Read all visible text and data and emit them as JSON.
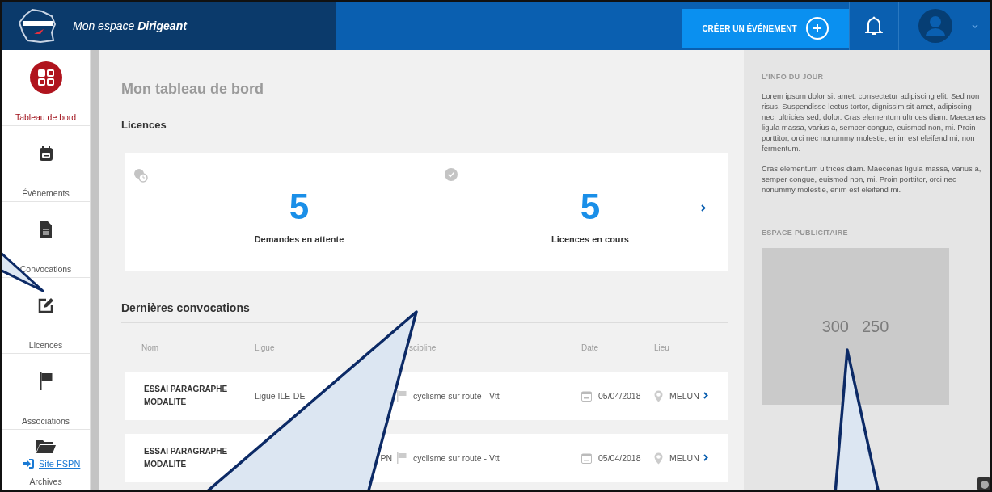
{
  "header": {
    "title": "Mon espace **Dirigeant**",
    "create_button": "CRÉER UN ÉVÉNEMENT"
  },
  "sidebar": {
    "items": [
      {
        "label": "Tableau de bord",
        "selected": true
      },
      {
        "label": "Évènements",
        "selected": false
      },
      {
        "label": "Convocations",
        "selected": false
      },
      {
        "label": "Licences",
        "selected": false
      },
      {
        "label": "Associations",
        "selected": false
      },
      {
        "label": "Archives",
        "selected": false
      }
    ],
    "site_link": "Site FSPN"
  },
  "page_title": "Mon tableau de bord",
  "licences": {
    "title": "Licences",
    "stats": [
      {
        "value": "5",
        "label": "Demandes en attente"
      },
      {
        "value": "5",
        "label": "Licences en cours"
      }
    ]
  },
  "convocations": {
    "title": "Dernières convocations",
    "columns": [
      "Nom",
      "Ligue",
      "scipline",
      "Date",
      "Lieu"
    ],
    "rows": [
      {
        "name": "ESSAI PARAGRAPHE MODALITE",
        "ligue": "Ligue ILE-DE-",
        "discipline": "cyclisme sur route - Vtt",
        "date": "05/04/2018",
        "lieu": "MELUN"
      },
      {
        "name": "ESSAI PARAGRAPHE MODALITE",
        "ligue": "PN",
        "discipline": "cyclisme sur route - Vtt",
        "date": "05/04/2018",
        "lieu": "MELUN"
      }
    ]
  },
  "aside": {
    "info_title": "L'INFO DU JOUR",
    "paragraphs": [
      "Lorem ipsum dolor sit amet, consectetur adipiscing elit. Sed non risus. Suspendisse lectus tortor, dignissim sit amet, adipiscing nec, ultricies sed, dolor. Cras elementum ultrices diam. Maecenas ligula massa, varius a, semper congue, euismod non, mi. Proin porttitor, orci nec nonummy molestie, enim est eleifend mi, non fermentum.",
      "Cras elementum ultrices diam. Maecenas ligula massa, varius a, semper congue, euismod non, mi. Proin porttitor, orci nec nonummy molestie, enim est eleifend mi."
    ],
    "ad_title": "ESPACE PUBLICITAIRE",
    "ad_texts": [
      "300",
      "250"
    ]
  }
}
